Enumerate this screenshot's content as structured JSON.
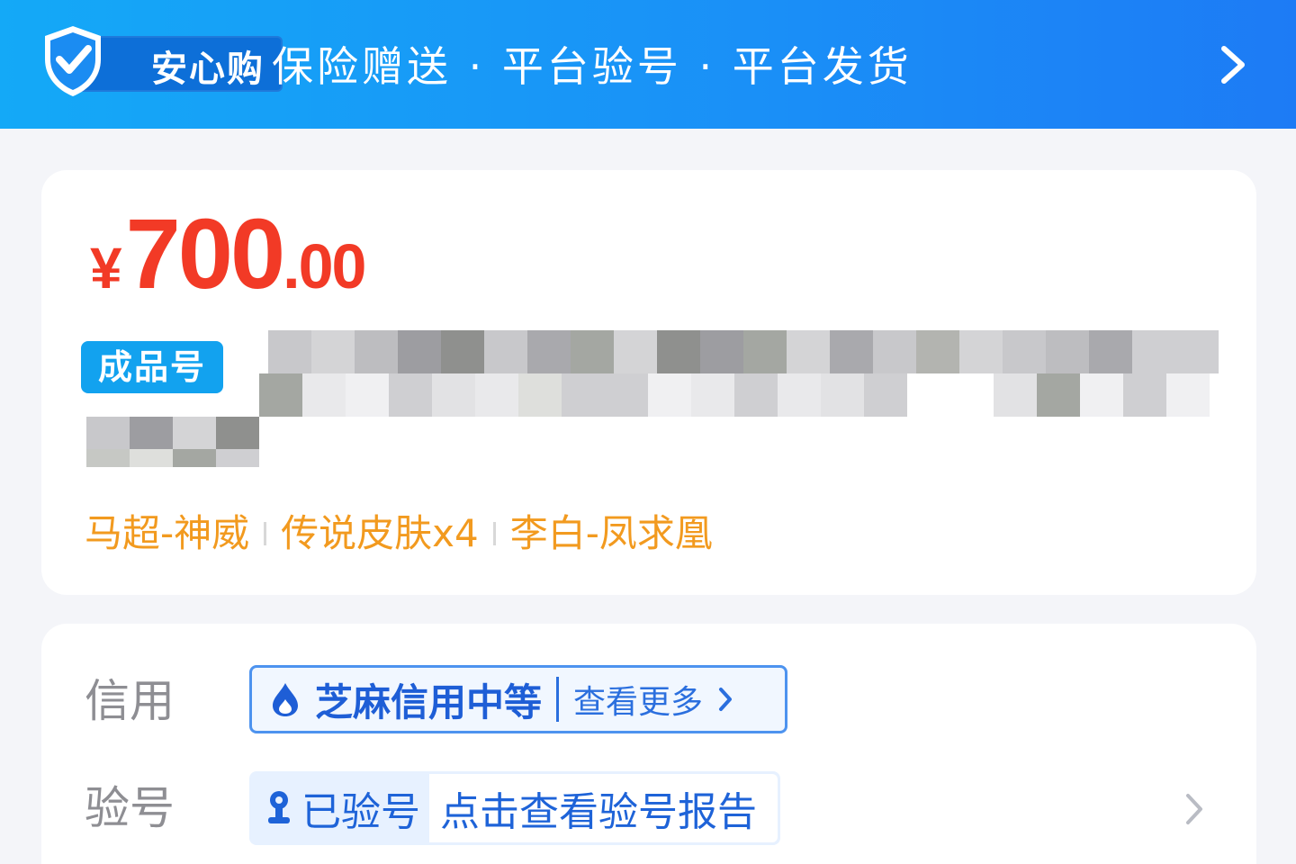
{
  "banner": {
    "brand": "安心购",
    "slogan": "保险赠送 · 平台验号 · 平台发货",
    "arrow_icon": "chevron-right-icon",
    "brand_icon": "shield-check-icon"
  },
  "colors": {
    "banner_start": "#14a9f7",
    "banner_end": "#1d7bf5",
    "price": "#f23a26",
    "feature_text": "#f29a1f",
    "tag_bg": "#12a2ef",
    "link_blue": "#1e63d8"
  },
  "listing": {
    "price_currency": "¥",
    "price_integer": "700",
    "price_decimal": ".00",
    "tag": "成品号",
    "title_redacted": true,
    "features": [
      "马超-神威",
      "传说皮肤x4",
      "李白-凤求凰"
    ]
  },
  "details": {
    "credit": {
      "label": "信用",
      "value": "芝麻信用中等",
      "more": "查看更多",
      "icon": "flame-drop-icon"
    },
    "verify": {
      "label": "验号",
      "status": "已验号",
      "link": "点击查看验号报告",
      "icon": "verified-badge-icon"
    }
  }
}
